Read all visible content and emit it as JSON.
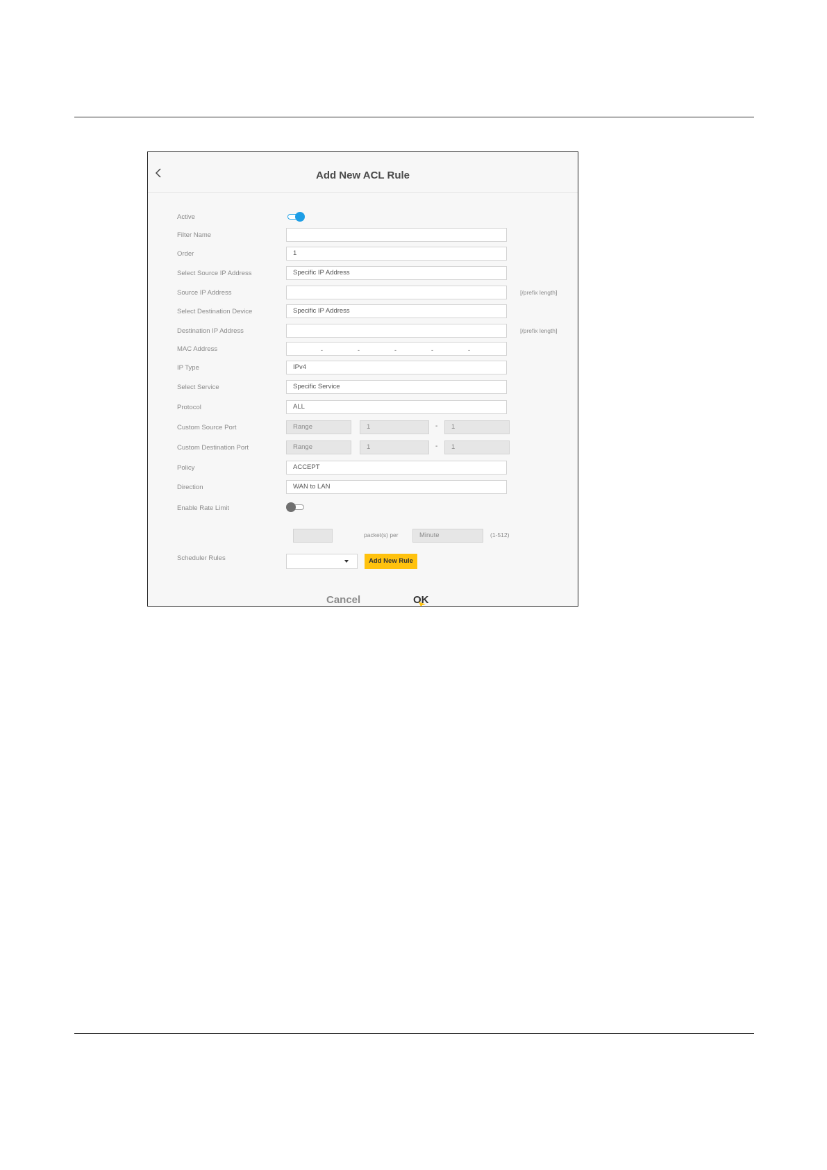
{
  "dialog": {
    "title": "Add New ACL Rule",
    "labels": {
      "active": "Active",
      "filter_name": "Filter Name",
      "order": "Order",
      "select_source_ip": "Select Source IP Address",
      "source_ip": "Source IP Address",
      "select_destination_device": "Select Destination Device",
      "destination_ip": "Destination IP Address",
      "mac_address": "MAC Address",
      "ip_type": "IP Type",
      "select_service": "Select Service",
      "protocol": "Protocol",
      "custom_source_port": "Custom Source Port",
      "custom_destination_port": "Custom Destination Port",
      "policy": "Policy",
      "direction": "Direction",
      "enable_rate_limit": "Enable Rate Limit",
      "scheduler_rules": "Scheduler Rules"
    },
    "values": {
      "filter_name": "",
      "order": "1",
      "select_source_ip": "Specific IP Address",
      "source_ip": "",
      "select_destination_device": "Specific IP Address",
      "destination_ip": "",
      "ip_type": "IPv4",
      "select_service": "Specific Service",
      "protocol": "ALL",
      "source_port_mode": "Range",
      "source_port_start": "1",
      "source_port_end": "1",
      "destination_port_mode": "Range",
      "destination_port_start": "1",
      "destination_port_end": "1",
      "policy": "ACCEPT",
      "direction": "WAN to LAN",
      "rate_packets": "",
      "rate_unit": "Minute",
      "scheduler": ""
    },
    "hints": {
      "source_prefix": "[/prefix length]",
      "destination_prefix": "[/prefix length]",
      "packets_per": "packet(s) per",
      "rate_range": "(1-512)"
    },
    "port_dash": "-",
    "mac_separator": "-",
    "toggles": {
      "active": true,
      "enable_rate_limit": false
    },
    "buttons": {
      "add_new_rule": "Add New Rule",
      "cancel": "Cancel",
      "ok": "OK"
    },
    "colors": {
      "accent_blue": "#1e9ee6",
      "add_button": "#ffc20e"
    },
    "icons": {
      "back": "chevron-left-icon",
      "dropdown": "caret-down-icon"
    }
  }
}
